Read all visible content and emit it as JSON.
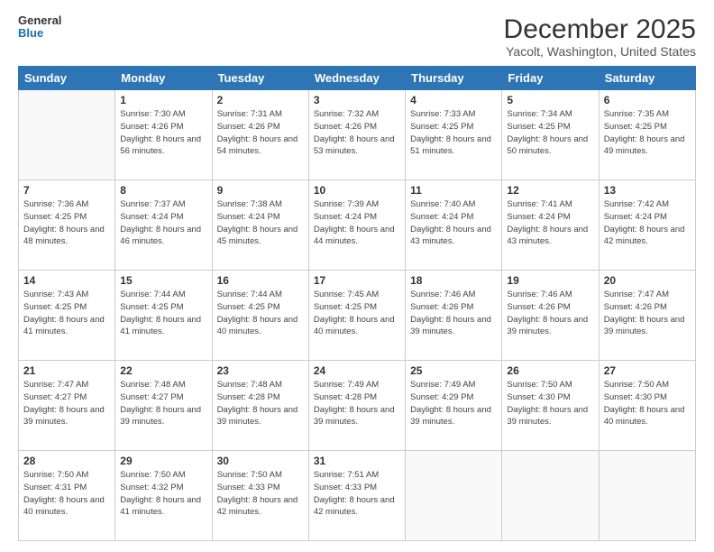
{
  "logo": {
    "line1": "General",
    "line2": "Blue"
  },
  "title": "December 2025",
  "subtitle": "Yacolt, Washington, United States",
  "days_header": [
    "Sunday",
    "Monday",
    "Tuesday",
    "Wednesday",
    "Thursday",
    "Friday",
    "Saturday"
  ],
  "weeks": [
    [
      {
        "day": "",
        "sunrise": "",
        "sunset": "",
        "daylight": ""
      },
      {
        "day": "1",
        "sunrise": "Sunrise: 7:30 AM",
        "sunset": "Sunset: 4:26 PM",
        "daylight": "Daylight: 8 hours and 56 minutes."
      },
      {
        "day": "2",
        "sunrise": "Sunrise: 7:31 AM",
        "sunset": "Sunset: 4:26 PM",
        "daylight": "Daylight: 8 hours and 54 minutes."
      },
      {
        "day": "3",
        "sunrise": "Sunrise: 7:32 AM",
        "sunset": "Sunset: 4:26 PM",
        "daylight": "Daylight: 8 hours and 53 minutes."
      },
      {
        "day": "4",
        "sunrise": "Sunrise: 7:33 AM",
        "sunset": "Sunset: 4:25 PM",
        "daylight": "Daylight: 8 hours and 51 minutes."
      },
      {
        "day": "5",
        "sunrise": "Sunrise: 7:34 AM",
        "sunset": "Sunset: 4:25 PM",
        "daylight": "Daylight: 8 hours and 50 minutes."
      },
      {
        "day": "6",
        "sunrise": "Sunrise: 7:35 AM",
        "sunset": "Sunset: 4:25 PM",
        "daylight": "Daylight: 8 hours and 49 minutes."
      }
    ],
    [
      {
        "day": "7",
        "sunrise": "Sunrise: 7:36 AM",
        "sunset": "Sunset: 4:25 PM",
        "daylight": "Daylight: 8 hours and 48 minutes."
      },
      {
        "day": "8",
        "sunrise": "Sunrise: 7:37 AM",
        "sunset": "Sunset: 4:24 PM",
        "daylight": "Daylight: 8 hours and 46 minutes."
      },
      {
        "day": "9",
        "sunrise": "Sunrise: 7:38 AM",
        "sunset": "Sunset: 4:24 PM",
        "daylight": "Daylight: 8 hours and 45 minutes."
      },
      {
        "day": "10",
        "sunrise": "Sunrise: 7:39 AM",
        "sunset": "Sunset: 4:24 PM",
        "daylight": "Daylight: 8 hours and 44 minutes."
      },
      {
        "day": "11",
        "sunrise": "Sunrise: 7:40 AM",
        "sunset": "Sunset: 4:24 PM",
        "daylight": "Daylight: 8 hours and 43 minutes."
      },
      {
        "day": "12",
        "sunrise": "Sunrise: 7:41 AM",
        "sunset": "Sunset: 4:24 PM",
        "daylight": "Daylight: 8 hours and 43 minutes."
      },
      {
        "day": "13",
        "sunrise": "Sunrise: 7:42 AM",
        "sunset": "Sunset: 4:24 PM",
        "daylight": "Daylight: 8 hours and 42 minutes."
      }
    ],
    [
      {
        "day": "14",
        "sunrise": "Sunrise: 7:43 AM",
        "sunset": "Sunset: 4:25 PM",
        "daylight": "Daylight: 8 hours and 41 minutes."
      },
      {
        "day": "15",
        "sunrise": "Sunrise: 7:44 AM",
        "sunset": "Sunset: 4:25 PM",
        "daylight": "Daylight: 8 hours and 41 minutes."
      },
      {
        "day": "16",
        "sunrise": "Sunrise: 7:44 AM",
        "sunset": "Sunset: 4:25 PM",
        "daylight": "Daylight: 8 hours and 40 minutes."
      },
      {
        "day": "17",
        "sunrise": "Sunrise: 7:45 AM",
        "sunset": "Sunset: 4:25 PM",
        "daylight": "Daylight: 8 hours and 40 minutes."
      },
      {
        "day": "18",
        "sunrise": "Sunrise: 7:46 AM",
        "sunset": "Sunset: 4:26 PM",
        "daylight": "Daylight: 8 hours and 39 minutes."
      },
      {
        "day": "19",
        "sunrise": "Sunrise: 7:46 AM",
        "sunset": "Sunset: 4:26 PM",
        "daylight": "Daylight: 8 hours and 39 minutes."
      },
      {
        "day": "20",
        "sunrise": "Sunrise: 7:47 AM",
        "sunset": "Sunset: 4:26 PM",
        "daylight": "Daylight: 8 hours and 39 minutes."
      }
    ],
    [
      {
        "day": "21",
        "sunrise": "Sunrise: 7:47 AM",
        "sunset": "Sunset: 4:27 PM",
        "daylight": "Daylight: 8 hours and 39 minutes."
      },
      {
        "day": "22",
        "sunrise": "Sunrise: 7:48 AM",
        "sunset": "Sunset: 4:27 PM",
        "daylight": "Daylight: 8 hours and 39 minutes."
      },
      {
        "day": "23",
        "sunrise": "Sunrise: 7:48 AM",
        "sunset": "Sunset: 4:28 PM",
        "daylight": "Daylight: 8 hours and 39 minutes."
      },
      {
        "day": "24",
        "sunrise": "Sunrise: 7:49 AM",
        "sunset": "Sunset: 4:28 PM",
        "daylight": "Daylight: 8 hours and 39 minutes."
      },
      {
        "day": "25",
        "sunrise": "Sunrise: 7:49 AM",
        "sunset": "Sunset: 4:29 PM",
        "daylight": "Daylight: 8 hours and 39 minutes."
      },
      {
        "day": "26",
        "sunrise": "Sunrise: 7:50 AM",
        "sunset": "Sunset: 4:30 PM",
        "daylight": "Daylight: 8 hours and 39 minutes."
      },
      {
        "day": "27",
        "sunrise": "Sunrise: 7:50 AM",
        "sunset": "Sunset: 4:30 PM",
        "daylight": "Daylight: 8 hours and 40 minutes."
      }
    ],
    [
      {
        "day": "28",
        "sunrise": "Sunrise: 7:50 AM",
        "sunset": "Sunset: 4:31 PM",
        "daylight": "Daylight: 8 hours and 40 minutes."
      },
      {
        "day": "29",
        "sunrise": "Sunrise: 7:50 AM",
        "sunset": "Sunset: 4:32 PM",
        "daylight": "Daylight: 8 hours and 41 minutes."
      },
      {
        "day": "30",
        "sunrise": "Sunrise: 7:50 AM",
        "sunset": "Sunset: 4:33 PM",
        "daylight": "Daylight: 8 hours and 42 minutes."
      },
      {
        "day": "31",
        "sunrise": "Sunrise: 7:51 AM",
        "sunset": "Sunset: 4:33 PM",
        "daylight": "Daylight: 8 hours and 42 minutes."
      },
      {
        "day": "",
        "sunrise": "",
        "sunset": "",
        "daylight": ""
      },
      {
        "day": "",
        "sunrise": "",
        "sunset": "",
        "daylight": ""
      },
      {
        "day": "",
        "sunrise": "",
        "sunset": "",
        "daylight": ""
      }
    ]
  ]
}
